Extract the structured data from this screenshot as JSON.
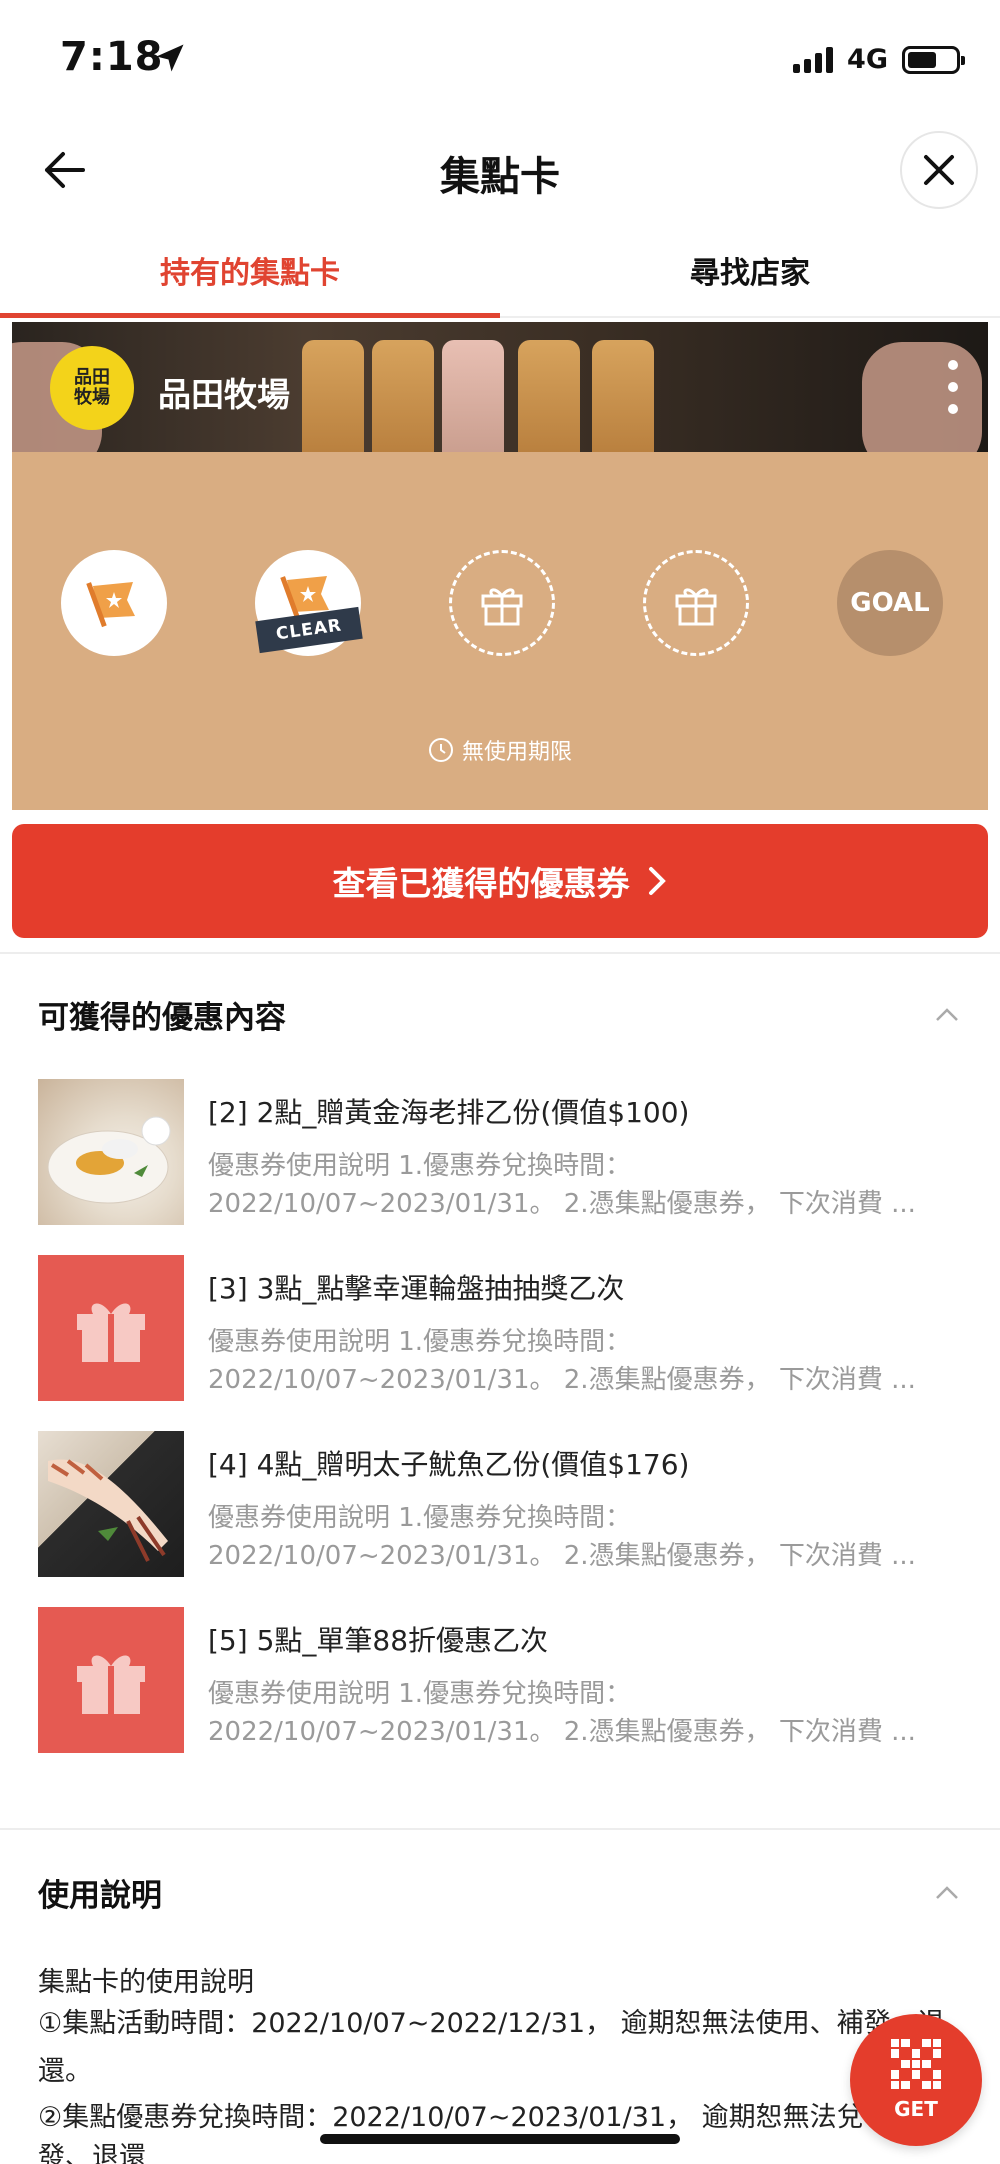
{
  "status": {
    "time": "7:18",
    "network": "4G"
  },
  "nav": {
    "title": "集點卡"
  },
  "tabs": [
    {
      "label": "持有的集點卡",
      "active": true
    },
    {
      "label": "尋找店家",
      "active": false
    }
  ],
  "card": {
    "brand_logo_text": "品田\n牧場",
    "brand_name": "品田牧場",
    "stamps": [
      "flag-icon",
      "flag-icon",
      "gift-icon",
      "gift-icon",
      "goal"
    ],
    "clear_label": "CLEAR",
    "goal_label": "GOAL",
    "expiry": "無使用期限",
    "colors": {
      "card_bg": "#d9ad82",
      "accent": "#e43d2c",
      "logo": "#f3d31a"
    }
  },
  "cta": {
    "label": "查看已獲得的優惠券"
  },
  "rewards": {
    "title": "可獲得的優惠內容",
    "items": [
      {
        "title": "[2] 2點_贈黃金海老排乙份(價值$100)",
        "desc1": "優惠券使用說明 1.優惠券兌換時間：",
        "desc2": "2022/10/07~2023/01/31。 2.憑集點優惠券， 下次消費 ...",
        "thumb": "photo"
      },
      {
        "title": "[3] 3點_點擊幸運輪盤抽抽獎乙次",
        "desc1": "優惠券使用說明 1.優惠券兌換時間：",
        "desc2": "2022/10/07~2023/01/31。 2.憑集點優惠券， 下次消費 ...",
        "thumb": "gift-icon"
      },
      {
        "title": "[4] 4點_贈明太子魷魚乙份(價值$176)",
        "desc1": "優惠券使用說明 1.優惠券兌換時間：",
        "desc2": "2022/10/07~2023/01/31。 2.憑集點優惠券， 下次消費 ...",
        "thumb": "photo"
      },
      {
        "title": "[5] 5點_單筆88折優惠乙次",
        "desc1": "優惠券使用說明 1.優惠券兌換時間：",
        "desc2": "2022/10/07~2023/01/31。 2.憑集點優惠券， 下次消費 ...",
        "thumb": "gift-icon"
      }
    ]
  },
  "usage": {
    "title": "使用說明",
    "subtitle": "集點卡的使用說明",
    "line1": "①集點活動時間：2022/10/07~2022/12/31， 逾期恕無法使用、補發、退",
    "line1b": "還。",
    "line2": "②集點優惠券兌換時間：2022/10/07~2023/01/31， 逾期恕無法兌",
    "line2b": "發、退還"
  },
  "get_button": {
    "label": "GET"
  }
}
